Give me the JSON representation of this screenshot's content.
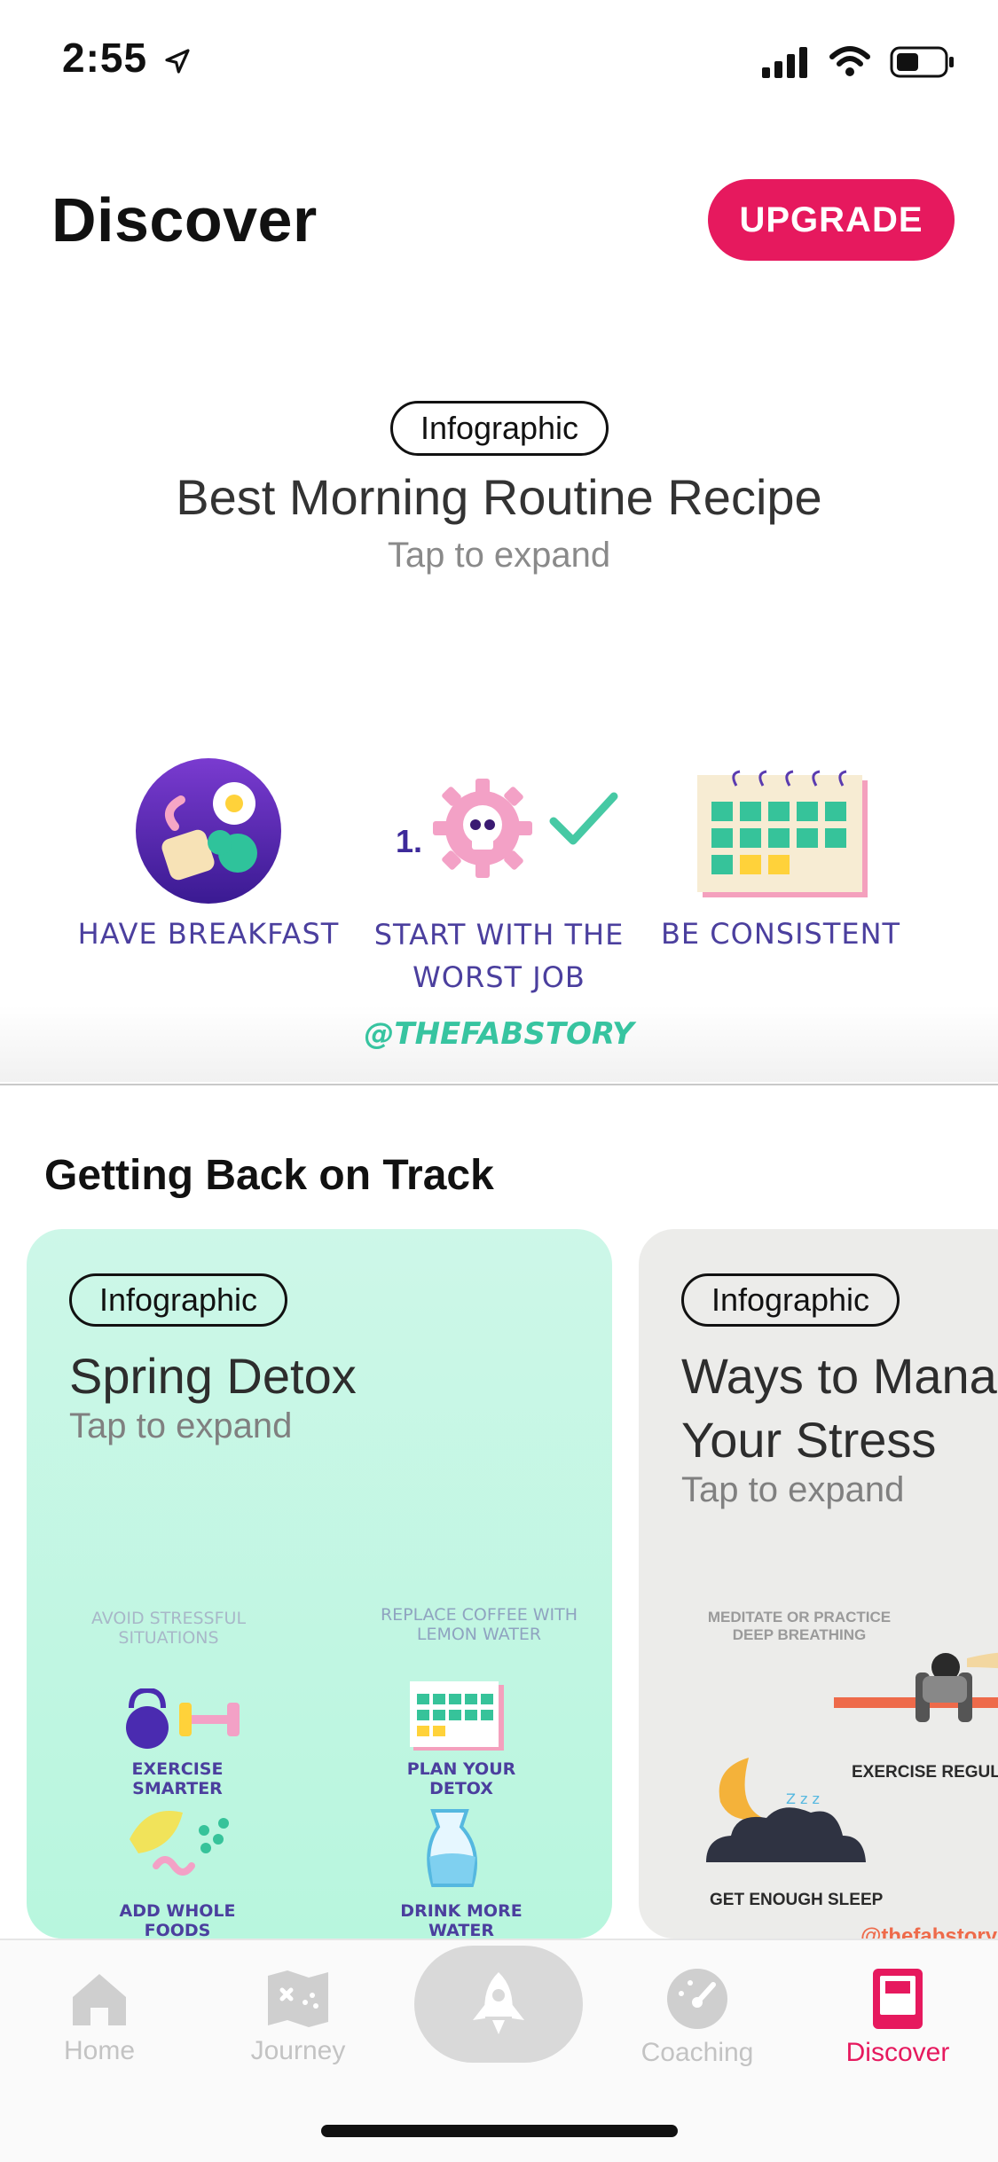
{
  "status": {
    "time": "2:55"
  },
  "header": {
    "title": "Discover",
    "upgrade_label": "UPGRADE",
    "accent": "#e6195e"
  },
  "featured": {
    "tag": "Infographic",
    "title": "Best Morning Routine Recipe",
    "subtitle": "Tap to expand",
    "items": [
      "HAVE BREAKFAST",
      "START WITH THE WORST JOB",
      "BE CONSISTENT"
    ],
    "step_number": "1.",
    "handle": "@THEFABSTORY"
  },
  "section": {
    "title": "Getting Back on Track",
    "cards": [
      {
        "tag": "Infographic",
        "title": "Spring Detox",
        "subtitle": "Tap to expand",
        "labels": {
          "avoid": "AVOID STRESSFUL SITUATIONS",
          "coffee": "REPLACE COFFEE WITH LEMON WATER",
          "exercise": "EXERCISE SMARTER",
          "plan": "PLAN YOUR DETOX",
          "foods": "ADD WHOLE FOODS",
          "water": "DRINK MORE WATER"
        }
      },
      {
        "tag": "Infographic",
        "title_line1": "Ways to Mana",
        "title_line2": "Your Stress",
        "subtitle": "Tap to expand",
        "labels": {
          "meditate": "MEDITATE OR PRACTICE DEEP BREATHING",
          "exercise": "EXERCISE REGULAR",
          "sleep": "GET ENOUGH SLEEP",
          "handle": "@thefabstory"
        }
      }
    ]
  },
  "tabbar": {
    "tabs": [
      {
        "label": "Home",
        "icon": "home-icon"
      },
      {
        "label": "Journey",
        "icon": "map-icon"
      },
      {
        "label": "Coaching",
        "icon": "gauge-icon"
      },
      {
        "label": "Discover",
        "icon": "book-icon",
        "active": true
      }
    ],
    "center_icon": "rocket-icon"
  }
}
